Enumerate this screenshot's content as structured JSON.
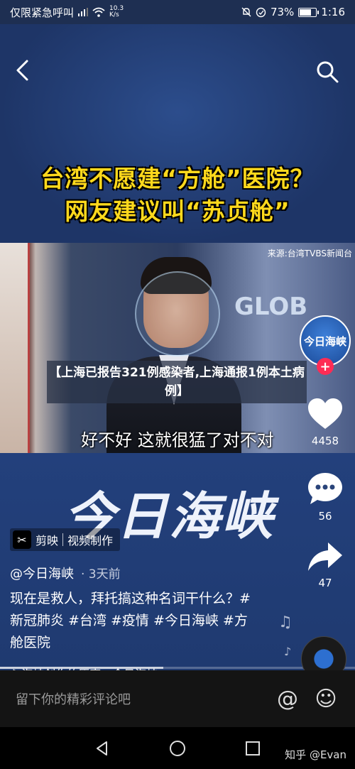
{
  "status_bar": {
    "carrier": "仅限紧急呼叫",
    "net_speed_value": "10.3",
    "net_speed_unit": "K/s",
    "battery": "73%",
    "battery_level": 0.73,
    "time": "1:16"
  },
  "video": {
    "headline_line1": "台湾不愿建“方舱”医院？",
    "headline_line2": "网友建议叫“苏贞舱”",
    "source_watermark": "来源:台湾TVBS新闻台",
    "studio_text": "GLOB",
    "subtitle": "好不好   这就很猛了对不对",
    "news_overlay": "【上海已报告321例感染者,上海通报1例本土病例】",
    "brand_text": "今日海峡",
    "capcut_logo": "✂",
    "capcut_name": "剪映",
    "capcut_tag": "视频制作",
    "progress": 0.46
  },
  "post": {
    "author": "@今日海峡",
    "time": "· 3天前",
    "caption": "现在是救人，拜托搞这种名词干什么？#新冠肺炎 #台湾 #疫情 #今日海峡 #方舱医院",
    "music_icon": "♪",
    "music": "海峡创作的原声 - 今日海峡"
  },
  "rail": {
    "avatar_text": "今日海峡",
    "follow_symbol": "+",
    "likes": "4458",
    "comments": "56",
    "shares": "47"
  },
  "comment_bar": {
    "placeholder": "留下你的精彩评论吧",
    "at_symbol": "@",
    "emoji_symbol": "☺"
  },
  "footer": {
    "watermark": "知乎 @Evan"
  },
  "icons": {
    "back": "back-arrow-icon",
    "search": "search-icon",
    "like": "heart-icon",
    "comment": "comment-bubble-icon",
    "share": "share-arrow-icon"
  },
  "colors": {
    "headline": "#ffd91c",
    "follow_badge": "#fe2c55",
    "comment_bar": "#141414"
  }
}
